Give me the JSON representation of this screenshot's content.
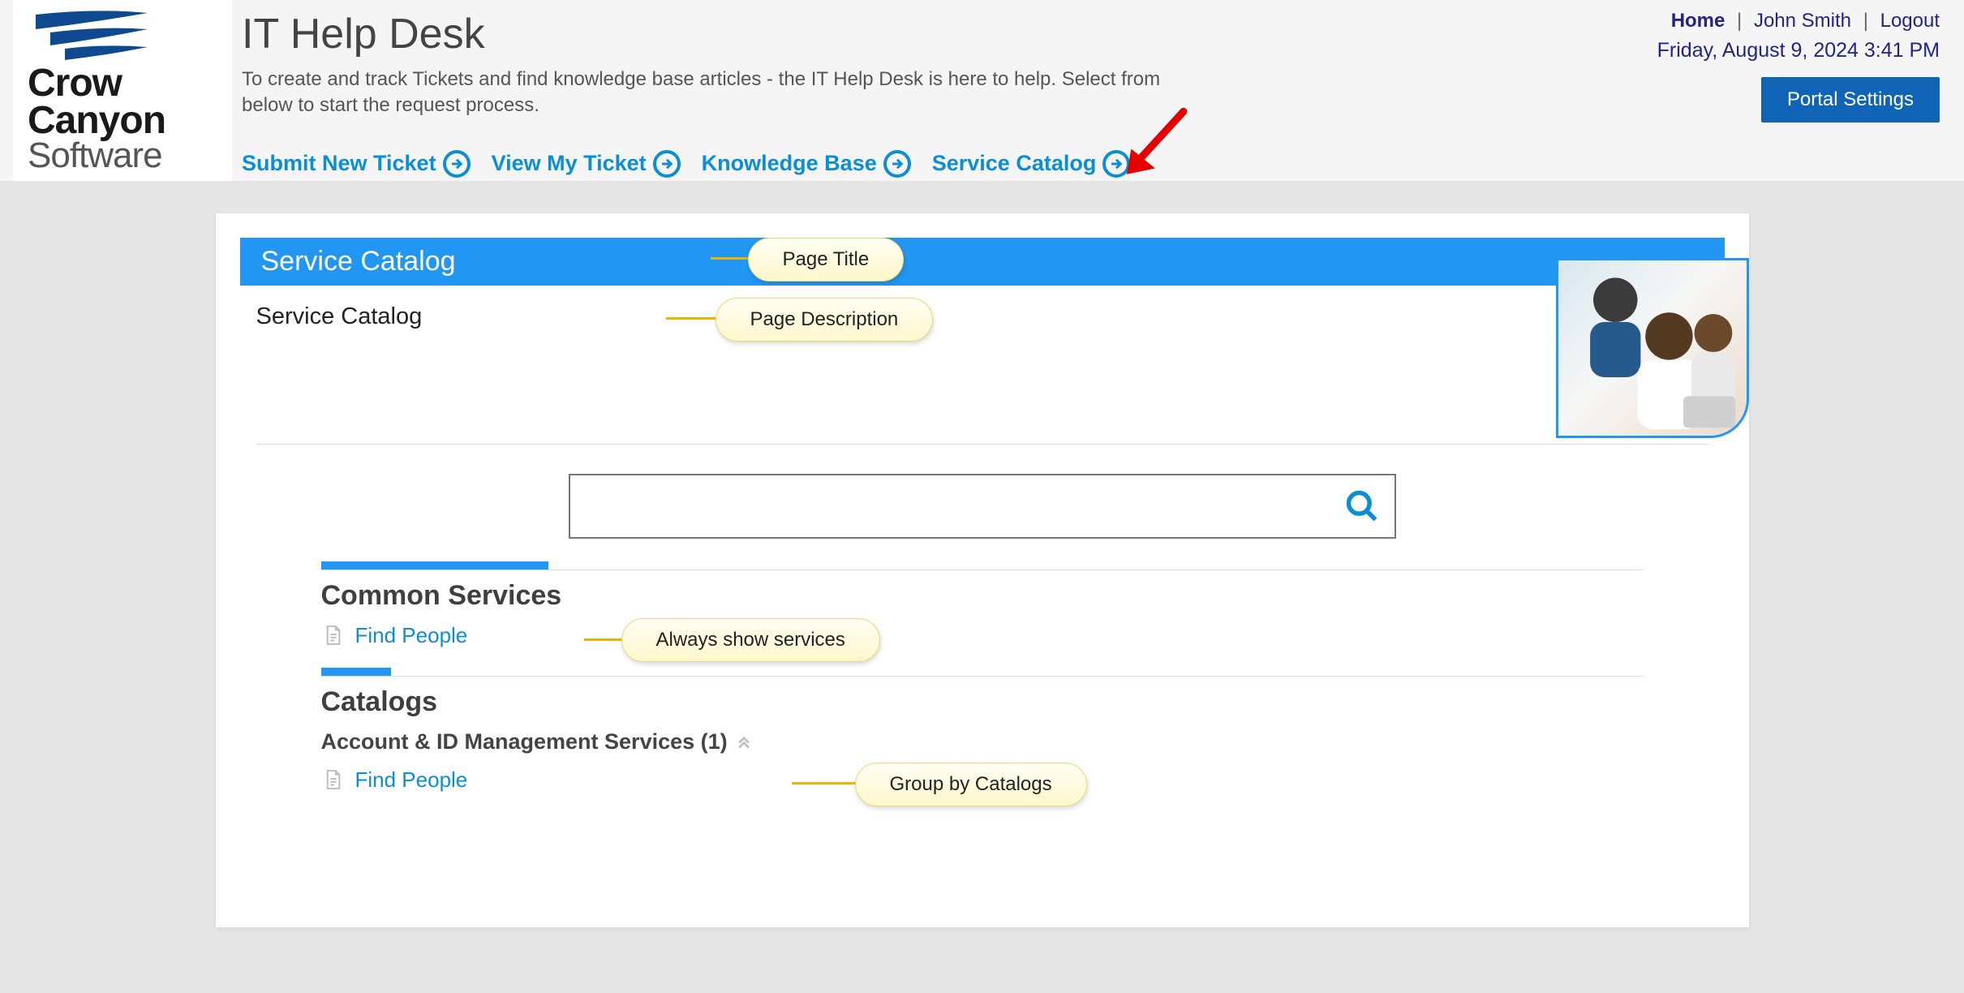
{
  "header": {
    "logo_name": "Crow Canyon Software",
    "portal_title": "IT Help Desk",
    "portal_desc": "To create and track Tickets and find knowledge base articles - the IT Help Desk is here to help. Select from below to start the request process.",
    "top_links": {
      "home": "Home",
      "user": "John Smith",
      "logout": "Logout"
    },
    "datetime": "Friday, August 9, 2024 3:41 PM",
    "portal_settings": "Portal Settings"
  },
  "nav": [
    {
      "label": "Submit New Ticket"
    },
    {
      "label": "View My Ticket"
    },
    {
      "label": "Knowledge Base"
    },
    {
      "label": "Service Catalog"
    }
  ],
  "page": {
    "title": "Service Catalog",
    "description": "Service Catalog",
    "search_placeholder": ""
  },
  "common_services": {
    "heading": "Common Services",
    "items": [
      {
        "label": "Find People"
      }
    ]
  },
  "catalogs": {
    "heading": "Catalogs",
    "groups": [
      {
        "name": "Account & ID Management Services (1)",
        "items": [
          {
            "label": "Find People"
          }
        ]
      }
    ]
  },
  "callouts": {
    "page_title": "Page Title",
    "page_description": "Page Description",
    "always_show": "Always show services",
    "group_by": "Group by Catalogs"
  }
}
